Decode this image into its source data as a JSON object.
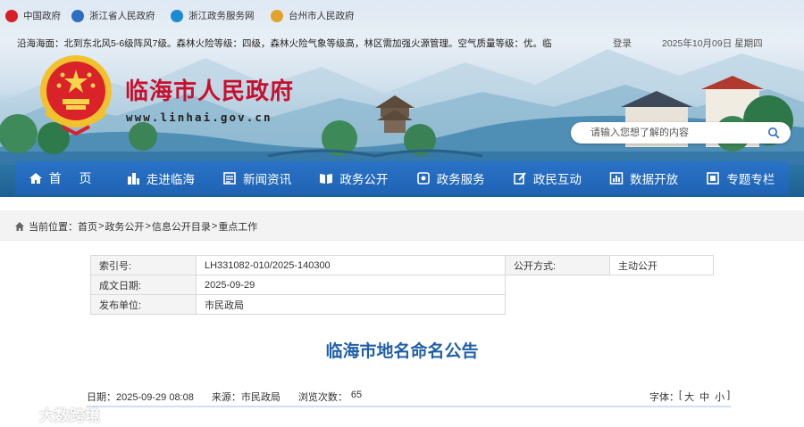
{
  "topbar": {
    "links": [
      {
        "label": "中国政府",
        "icon": "china-gov-emblem-icon"
      },
      {
        "label": "浙江省人民政府",
        "icon": "zhejiang-gov-icon"
      },
      {
        "label": "浙江政务服务网",
        "icon": "zhejiang-service-icon"
      },
      {
        "label": "台州市人民政府",
        "icon": "taizhou-gov-icon"
      }
    ],
    "ticker": "沿海海面：北到东北风5-6级阵风7级。森林火险等级：四级，森林火险气象等级高，林区需加强火源管理。空气质量等级：优。临",
    "login": "登录",
    "date": "2025年10月09日 星期四"
  },
  "banner": {
    "title": "临海市人民政府",
    "url": "www.linhai.gov.cn",
    "search_placeholder": "请输入您想了解的内容"
  },
  "nav": {
    "items": [
      {
        "label": "首 页",
        "icon": "home-icon"
      },
      {
        "label": "走进临海",
        "icon": "city-icon"
      },
      {
        "label": "新闻资讯",
        "icon": "news-icon"
      },
      {
        "label": "政务公开",
        "icon": "open-book-icon"
      },
      {
        "label": "政务服务",
        "icon": "service-icon"
      },
      {
        "label": "政民互动",
        "icon": "edit-icon"
      },
      {
        "label": "数据开放",
        "icon": "data-icon"
      },
      {
        "label": "专题专栏",
        "icon": "column-icon"
      }
    ]
  },
  "breadcrumb": {
    "prefix": "当前位置：",
    "items": [
      "首页",
      "政务公开",
      "信息公开目录",
      "重点工作"
    ]
  },
  "meta": {
    "index_label": "索引号:",
    "index_value": "LH331082-010/2025-140300",
    "date_label": "成文日期:",
    "date_value": "2025-09-29",
    "org_label": "发布单位:",
    "org_value": "市民政局",
    "mode_label": "公开方式:",
    "mode_value": "主动公开"
  },
  "article": {
    "title": "临海市地名命名公告",
    "date": "日期：2025-09-29 08:08",
    "source": "来源：市民政局",
    "views_label": "浏览次数：",
    "views": "65",
    "fontsize_label": "字体：",
    "fontsize_open": "[",
    "fontsize_large": "大",
    "fontsize_medium": "中",
    "fontsize_small": "小",
    "fontsize_close": "]"
  },
  "watermark": {
    "text": "大数跨境"
  },
  "colors": {
    "title_red": "#c8102e",
    "nav_blue": "#1f62b3",
    "doc_title_blue": "#1f5fa8"
  }
}
